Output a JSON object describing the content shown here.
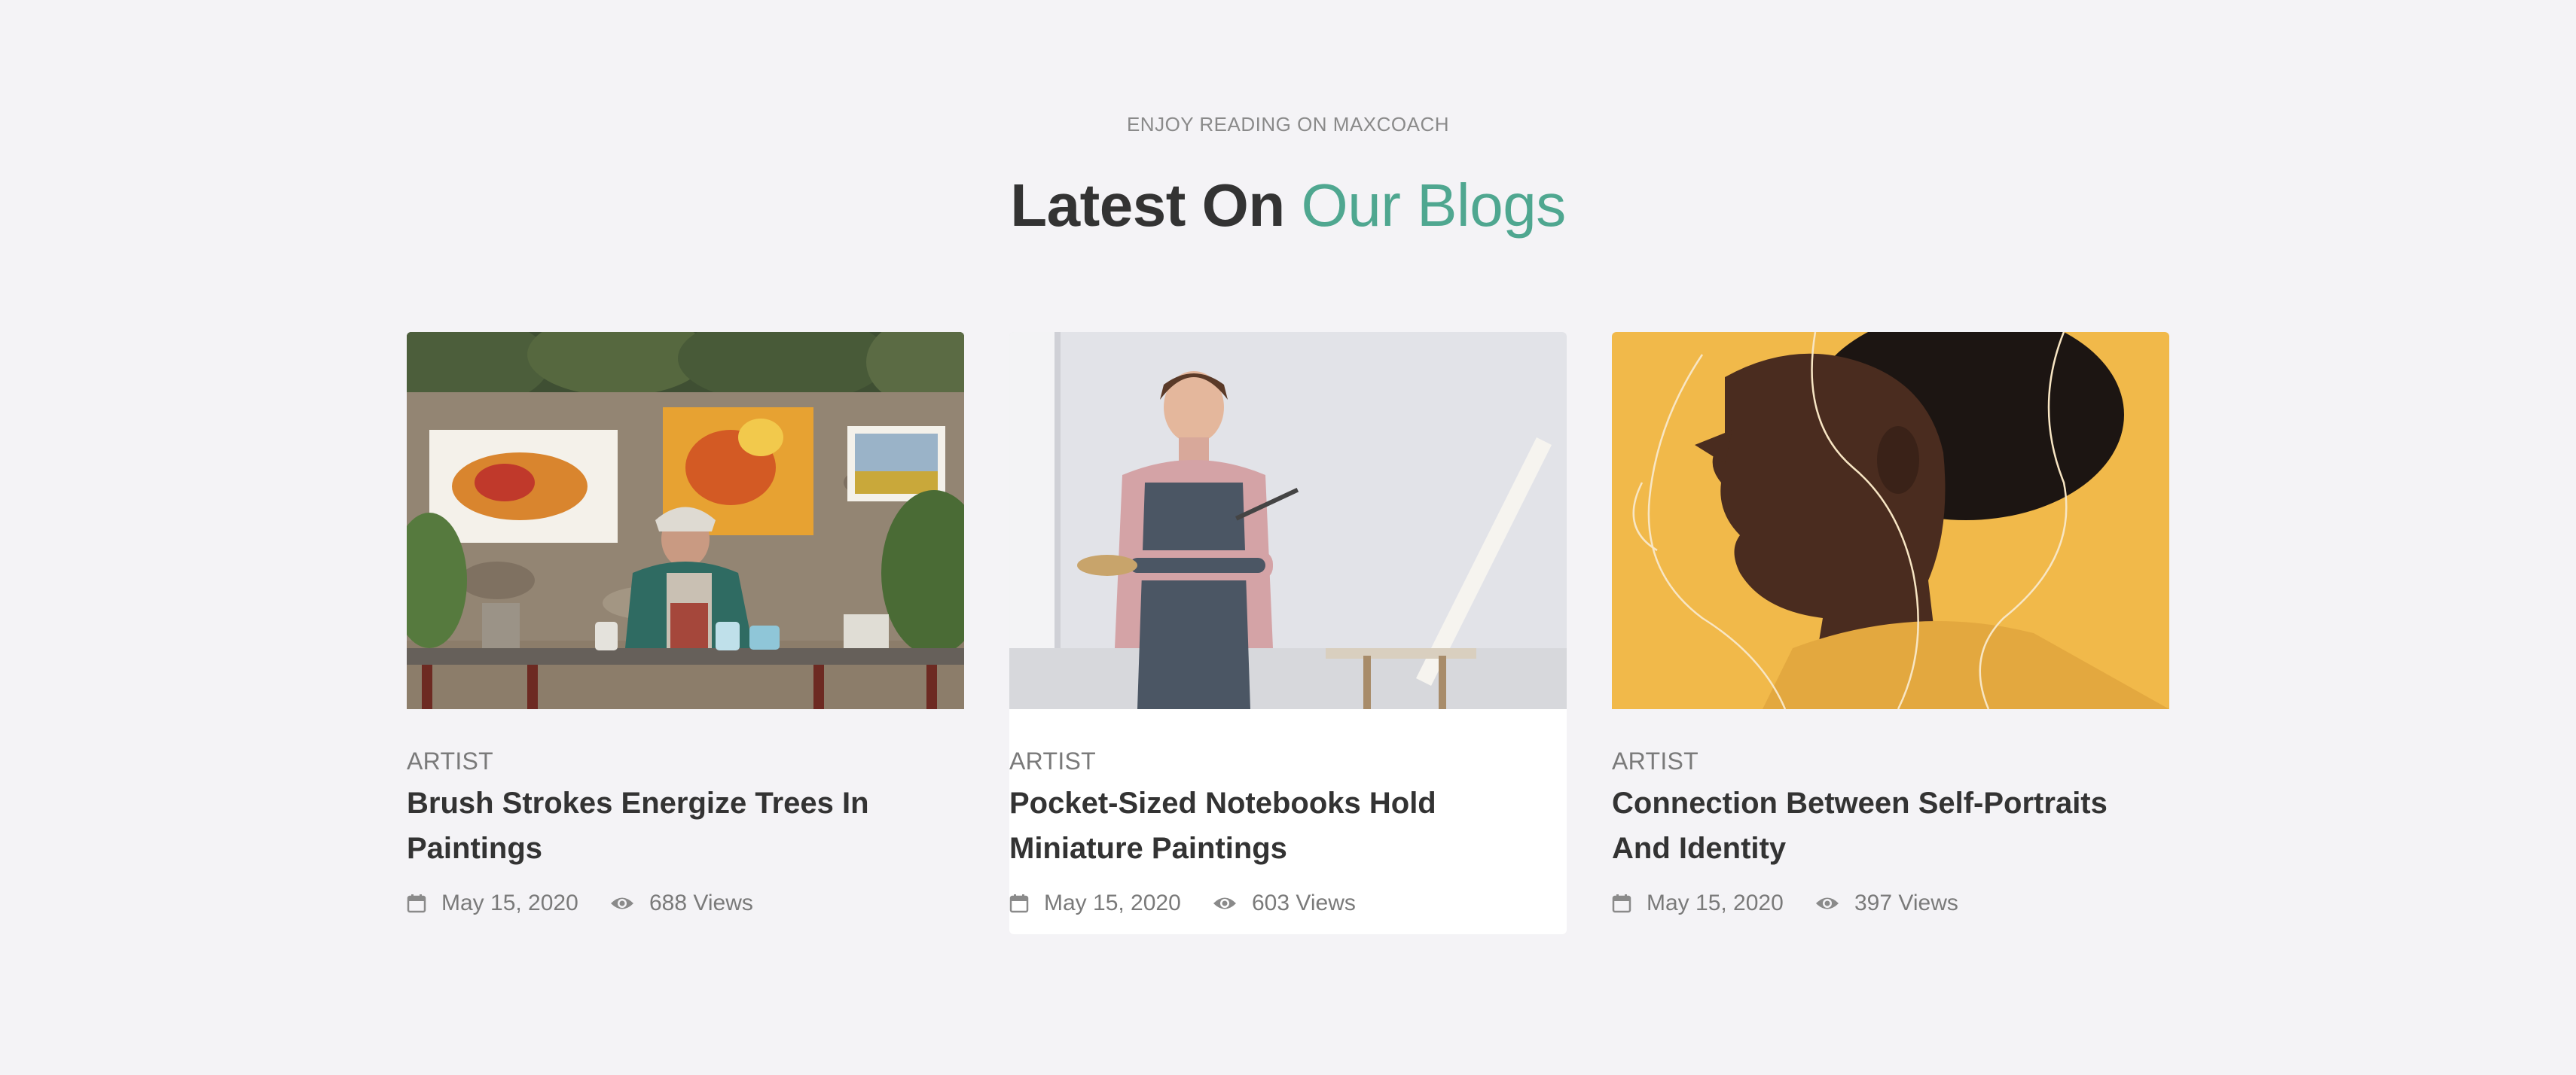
{
  "section": {
    "eyebrow": "ENJOY READING ON MAXCOACH",
    "heading_main": "Latest On",
    "heading_accent": "Our Blogs"
  },
  "colors": {
    "background": "#f4f3f6",
    "accent": "#4fa790",
    "text": "#333333",
    "muted": "#7a7a7a"
  },
  "posts": [
    {
      "category": "ARTIST",
      "title": "Brush Strokes Energize Trees In Paintings",
      "date": "May 15, 2020",
      "views": "688 Views",
      "image": "artist-painting-outdoors"
    },
    {
      "category": "ARTIST",
      "title": "Pocket-Sized Notebooks Hold Miniature Paintings",
      "date": "May 15, 2020",
      "views": "603 Views",
      "image": "woman-with-palette-and-easel"
    },
    {
      "category": "ARTIST",
      "title": "Connection Between Self-Portraits And Identity",
      "date": "May 15, 2020",
      "views": "397 Views",
      "image": "profile-portrait-yellow"
    }
  ],
  "icons": {
    "date": "calendar-icon",
    "views": "eye-icon"
  }
}
